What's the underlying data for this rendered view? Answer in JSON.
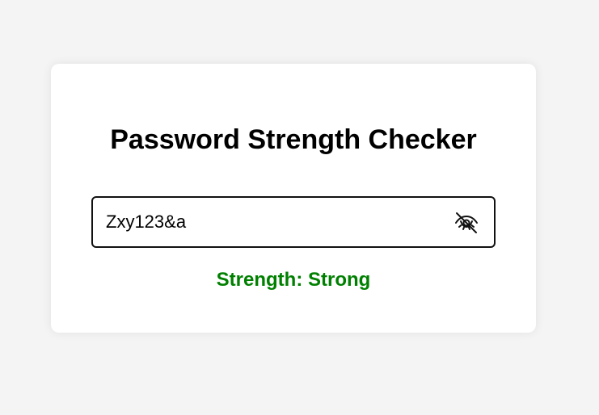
{
  "app": {
    "title": "Password Strength Checker"
  },
  "password_field": {
    "value": "Zxy123&a",
    "toggle_icon": "eye-off-icon"
  },
  "strength": {
    "label": "Strength:",
    "value": "Strong",
    "text": "Strength: Strong",
    "color": "#008000"
  },
  "colors": {
    "page_background": "#f4f4f4",
    "card_background": "#ffffff",
    "strong": "#008000"
  }
}
